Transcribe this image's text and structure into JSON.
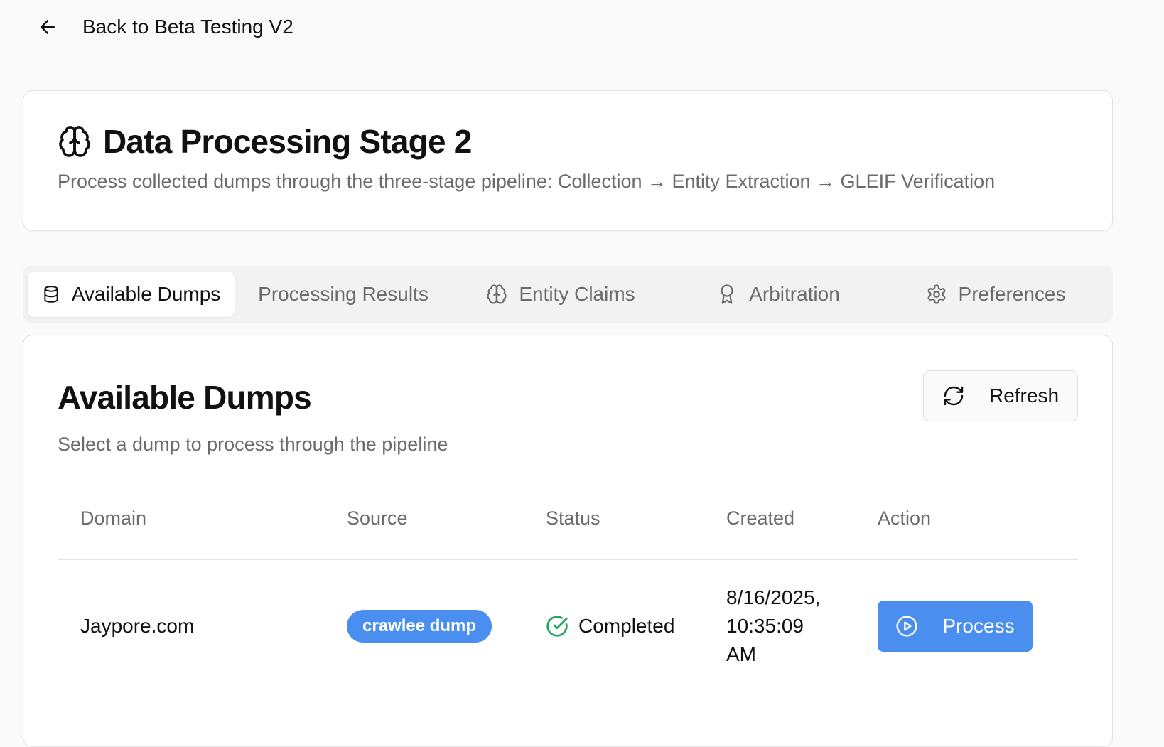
{
  "nav": {
    "back_label": "Back to Beta Testing V2",
    "back_icon": "arrow-left-icon"
  },
  "header": {
    "icon": "brain-icon",
    "title": "Data Processing Stage 2",
    "subtitle": "Process collected dumps through the three-stage pipeline: Collection → Entity Extraction → GLEIF Verification"
  },
  "tabs": [
    {
      "label": "Available Dumps",
      "icon": "database-icon",
      "active": true
    },
    {
      "label": "Processing Results",
      "icon": "",
      "active": false
    },
    {
      "label": "Entity Claims",
      "icon": "brain-icon",
      "active": false
    },
    {
      "label": "Arbitration",
      "icon": "award-icon",
      "active": false
    },
    {
      "label": "Preferences",
      "icon": "gear-icon",
      "active": false
    }
  ],
  "section": {
    "title": "Available Dumps",
    "subtitle": "Select a dump to process through the pipeline",
    "refresh_label": "Refresh",
    "refresh_icon": "refresh-icon"
  },
  "table": {
    "columns": [
      "Domain",
      "Source",
      "Status",
      "Created",
      "Action"
    ],
    "rows": [
      {
        "domain": "Jaypore.com",
        "source": "crawlee dump",
        "status": "Completed",
        "created": "8/16/2025, 10:35:09 AM",
        "action": "Process"
      }
    ]
  },
  "colors": {
    "accent": "#4a8ff0",
    "success": "#22a55a",
    "muted": "#6b6b6b"
  }
}
